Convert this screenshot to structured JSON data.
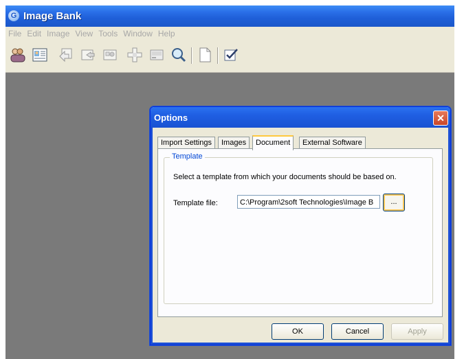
{
  "app": {
    "title": "Image Bank",
    "icon": "image-bank-logo-icon"
  },
  "menu": [
    "File",
    "Edit",
    "Image",
    "View",
    "Tools",
    "Window",
    "Help"
  ],
  "toolbar": {
    "buttons": [
      {
        "name": "users-icon"
      },
      {
        "name": "image-details-icon"
      },
      {
        "name": "import-icon"
      },
      {
        "name": "export-icon"
      },
      {
        "name": "photo-icon"
      },
      {
        "name": "move-icon"
      },
      {
        "name": "display-icon"
      },
      {
        "name": "search-icon"
      },
      {
        "name": "document-icon"
      },
      {
        "name": "options-check-icon"
      }
    ]
  },
  "dialog": {
    "title": "Options",
    "close_label": "✕",
    "tabs": [
      {
        "label": "Import Settings"
      },
      {
        "label": "Images"
      },
      {
        "label": "Document"
      },
      {
        "label": "External Software"
      }
    ],
    "active_tab": "Document",
    "group_title": "Template",
    "description": "Select a template from which your documents should be based on.",
    "template_label": "Template file:",
    "template_value": "C:\\Program\\2soft Technologies\\Image B",
    "browse_label": "...",
    "buttons": {
      "ok": "OK",
      "cancel": "Cancel",
      "apply": "Apply"
    }
  }
}
